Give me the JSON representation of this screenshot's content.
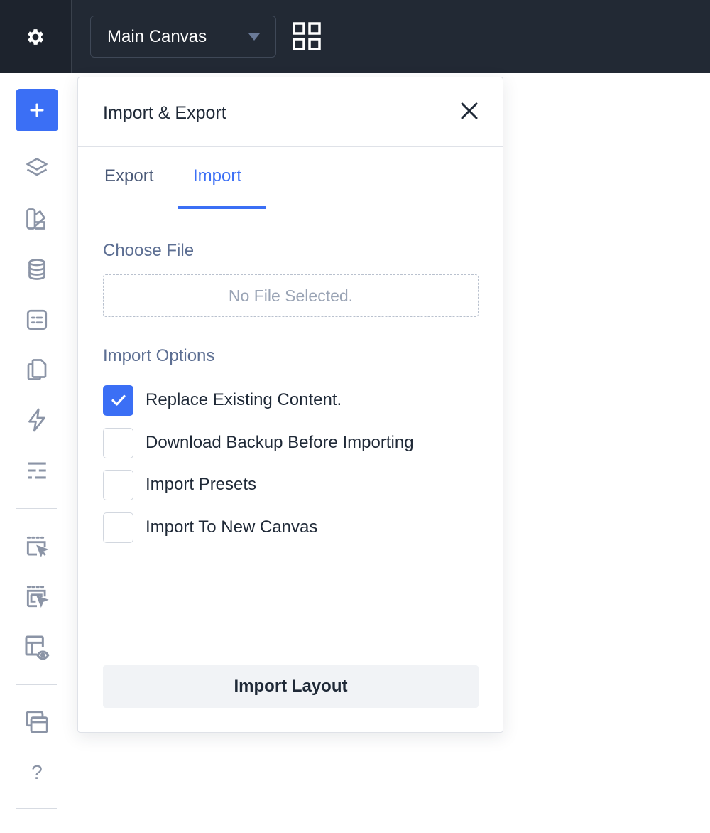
{
  "topbar": {
    "canvas_select": {
      "selected": "Main Canvas"
    }
  },
  "sidebar": {
    "items": [
      {
        "icon": "plus-icon",
        "active": true
      },
      {
        "icon": "layers-icon"
      },
      {
        "icon": "palette-icon"
      },
      {
        "icon": "database-icon"
      },
      {
        "icon": "form-icon"
      },
      {
        "icon": "copy-pages-icon"
      },
      {
        "icon": "lightning-icon"
      },
      {
        "icon": "sliders-icon"
      },
      {
        "icon": "select-element-icon"
      },
      {
        "icon": "select-elements-icon"
      },
      {
        "icon": "preview-layout-icon"
      },
      {
        "icon": "windows-icon"
      },
      {
        "icon": "help-icon",
        "glyph": "?"
      }
    ]
  },
  "panel": {
    "title": "Import & Export",
    "tabs": [
      {
        "label": "Export",
        "active": false
      },
      {
        "label": "Import",
        "active": true
      }
    ],
    "choose_file": {
      "label": "Choose File",
      "value": "No File Selected."
    },
    "import_options": {
      "label": "Import Options",
      "options": [
        {
          "label": "Replace Existing Content.",
          "checked": true
        },
        {
          "label": "Download Backup Before Importing",
          "checked": false
        },
        {
          "label": "Import Presets",
          "checked": false
        },
        {
          "label": "Import To New Canvas",
          "checked": false
        }
      ]
    },
    "submit_label": "Import Layout"
  },
  "colors": {
    "accent": "#3b6ff5",
    "topbar": "#222934",
    "muted_label": "#5d6f93"
  }
}
